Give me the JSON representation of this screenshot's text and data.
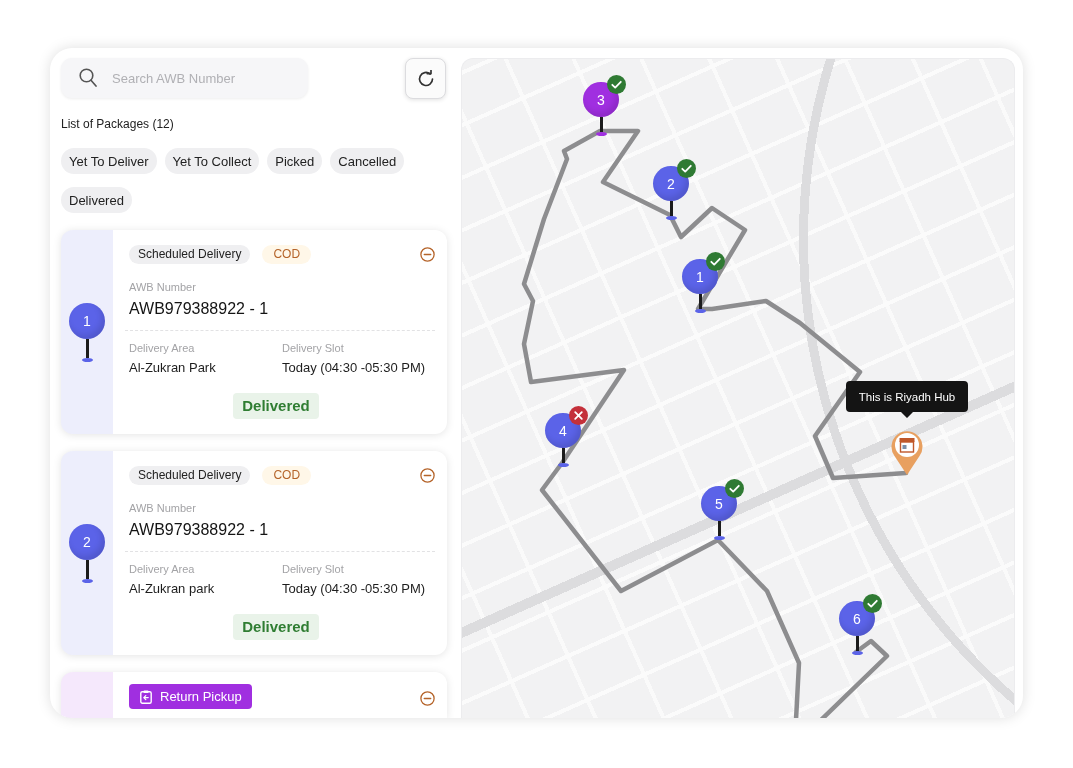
{
  "search": {
    "placeholder": "Search AWB Number"
  },
  "packages_heading": "List of Packages (12)",
  "filters": [
    {
      "label": "Yet To Deliver",
      "selected": false
    },
    {
      "label": "Yet To Collect",
      "selected": false
    },
    {
      "label": "Picked",
      "selected": false
    },
    {
      "label": "Cancelled",
      "selected": false
    },
    {
      "label": "Delivered",
      "selected": false
    }
  ],
  "packages": [
    {
      "kind": "delivery",
      "color": "#5b63e8",
      "pin": "1",
      "tags": [
        {
          "kind": "type",
          "label": "Scheduled Delivery"
        },
        {
          "kind": "payment",
          "label": "COD"
        }
      ],
      "awb_label": "AWB Number",
      "awb": "AWB979388922 - 1",
      "area_label": "Delivery Area",
      "area": "Al-Zukran Park",
      "slot_label": "Delivery Slot",
      "slot": "Today (04:30 -05:30 PM)",
      "status": "Delivered"
    },
    {
      "kind": "delivery",
      "color": "#5b63e8",
      "pin": "2",
      "tags": [
        {
          "kind": "type",
          "label": "Scheduled Delivery"
        },
        {
          "kind": "payment",
          "label": "COD"
        }
      ],
      "awb_label": "AWB Number",
      "awb": "AWB979388922 - 1",
      "area_label": "Delivery Area",
      "area": "Al-Zukran park",
      "slot_label": "Delivery Slot",
      "slot": "Today (04:30 -05:30 PM)",
      "status": "Delivered"
    },
    {
      "kind": "return_pickup",
      "color": "#a02fe0",
      "tags": [
        {
          "kind": "return",
          "label": "Return Pickup"
        }
      ]
    }
  ],
  "map": {
    "tooltip": "This is Riyadh Hub",
    "stops": [
      {
        "number": "1",
        "color": "#5b63e8",
        "delivered": true
      },
      {
        "number": "2",
        "color": "#5b63e8",
        "delivered": true
      },
      {
        "number": "3",
        "color": "#a02fe0",
        "delivered": true
      },
      {
        "number": "4",
        "color": "#5b63e8",
        "delivered": false
      },
      {
        "number": "5",
        "color": "#5b63e8",
        "delivered": true
      },
      {
        "number": "6",
        "color": "#5b63e8",
        "delivered": true
      }
    ]
  }
}
